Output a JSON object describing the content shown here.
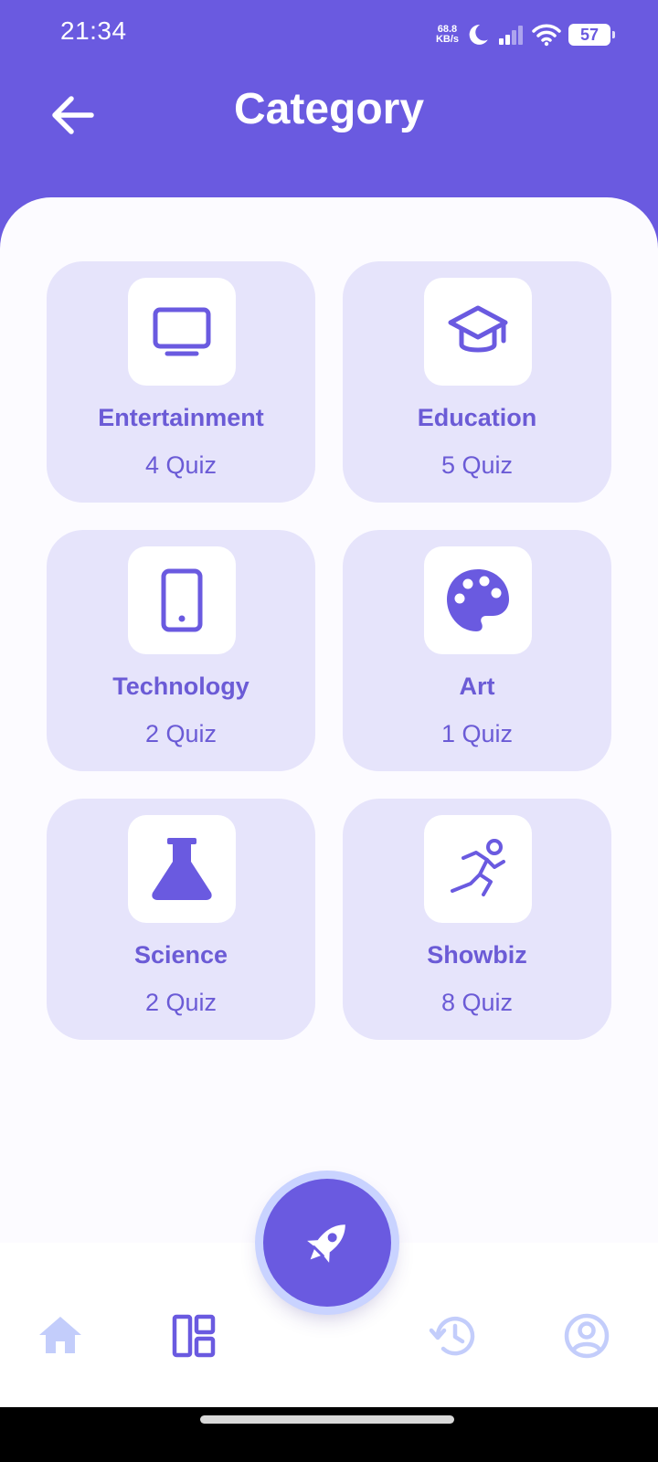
{
  "status_bar": {
    "time": "21:34",
    "net_speed_value": "68.8",
    "net_speed_unit": "KB/s",
    "battery": "57",
    "icons": [
      "moon-icon",
      "signal-icon",
      "wifi-icon",
      "battery-icon"
    ]
  },
  "header": {
    "title": "Category",
    "back_icon": "arrow-left-icon"
  },
  "categories": [
    {
      "name": "Entertainment",
      "count": "4 Quiz",
      "icon": "tv-icon"
    },
    {
      "name": "Education",
      "count": "5 Quiz",
      "icon": "graduation-cap-icon"
    },
    {
      "name": "Technology",
      "count": "2 Quiz",
      "icon": "smartphone-icon"
    },
    {
      "name": "Art",
      "count": "1 Quiz",
      "icon": "palette-icon"
    },
    {
      "name": "Science",
      "count": "2 Quiz",
      "icon": "flask-icon"
    },
    {
      "name": "Showbiz",
      "count": "8 Quiz",
      "icon": "running-person-icon"
    }
  ],
  "bottom_nav": {
    "items": [
      "home-icon",
      "dashboard-icon",
      "history-icon",
      "profile-icon"
    ],
    "active": "dashboard-icon",
    "fab_icon": "rocket-icon"
  },
  "colors": {
    "primary": "#6a5ae0",
    "card_bg": "#e6e4fb",
    "card_text": "#6b5bd6",
    "nav_inactive": "#c3cdfb",
    "fab_ring": "#c9d3ff"
  }
}
